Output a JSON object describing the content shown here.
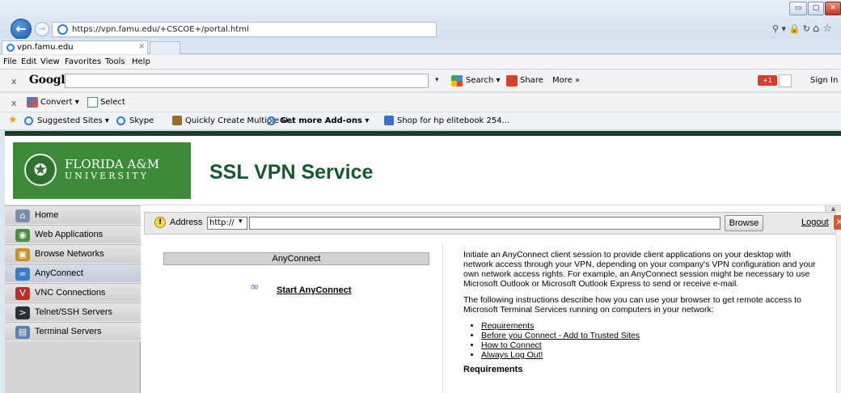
{
  "window": {
    "url": "https://vpn.famu.edu/+CSCOE+/portal.html",
    "tab_title": "vpn.famu.edu",
    "tab_close": "×",
    "controls": {
      "minimize": "▭",
      "maximize": "▢",
      "close": "✕"
    },
    "url_controls": "⚲ ▾ 🔒 ↻",
    "tool_icons": "⌂ ☆"
  },
  "menu": [
    "File",
    "Edit",
    "View",
    "Favorites",
    "Tools",
    "Help"
  ],
  "google_toolbar": {
    "close": "x",
    "logo": "Google",
    "search_label": "Search ▾",
    "share_label": "Share",
    "more_label": "More »",
    "plus_label": "+1",
    "signin_label": "Sign In"
  },
  "convert_toolbar": {
    "close": "x",
    "convert_label": "Convert ▾",
    "select_label": "Select"
  },
  "favorites_bar": {
    "items": [
      "Suggested Sites ▾",
      "Skype",
      "Quickly Create Multiple U...",
      "Get more Add-ons ▾",
      "Shop for hp elitebook 254..."
    ]
  },
  "banner": {
    "logo_line1": "FLORIDA A&M",
    "logo_line2": "UNIVERSITY",
    "title": "SSL VPN Service"
  },
  "sidebar": {
    "items": [
      {
        "label": "Home",
        "icon": "house-icon",
        "color": "#7b8ea8",
        "glyph": "⌂"
      },
      {
        "label": "Web Applications",
        "icon": "globe-icon",
        "color": "#4d8f3e",
        "glyph": "◉"
      },
      {
        "label": "Browse Networks",
        "icon": "network-folder-icon",
        "color": "#c98e24",
        "glyph": "▣"
      },
      {
        "label": "AnyConnect",
        "icon": "anyconnect-icon",
        "color": "#3a7bc7",
        "glyph": "∞"
      },
      {
        "label": "VNC Connections",
        "icon": "vnc-icon",
        "color": "#b5302a",
        "glyph": "V"
      },
      {
        "label": "Telnet/SSH Servers",
        "icon": "terminal-icon",
        "color": "#2b2f38",
        "glyph": ">"
      },
      {
        "label": "Terminal Servers",
        "icon": "terminal-server-icon",
        "color": "#5a7fb0",
        "glyph": "▤"
      }
    ]
  },
  "portal_bar": {
    "address_label": "Address",
    "protocol": "http://",
    "browse_label": "Browse",
    "logout_label": "Logout"
  },
  "anyconnect": {
    "header": "AnyConnect",
    "start_label": "Start AnyConnect"
  },
  "info": {
    "para1": "Initiate an AnyConnect client session to provide client applications on your desktop with network access through your VPN, depending on your company's VPN configuration and your own network access rights. For example, an AnyConnect session might be necessary to use Microsoft Outlook or Microsoft Outlook Express to send or receive e-mail.",
    "para2": "The following instructions describe how you can use your browser to get remote access to Microsoft Terminal Services running on computers in your network:",
    "links": [
      "Requirements",
      "Before you Connect - Add to Trusted Sites",
      "How to Connect",
      "Always Log Out!"
    ],
    "heading": "Requirements"
  },
  "colors": {
    "famu_green": "#3d8a3a",
    "title_green": "#15582f",
    "topbar": "#1c3a2c"
  }
}
